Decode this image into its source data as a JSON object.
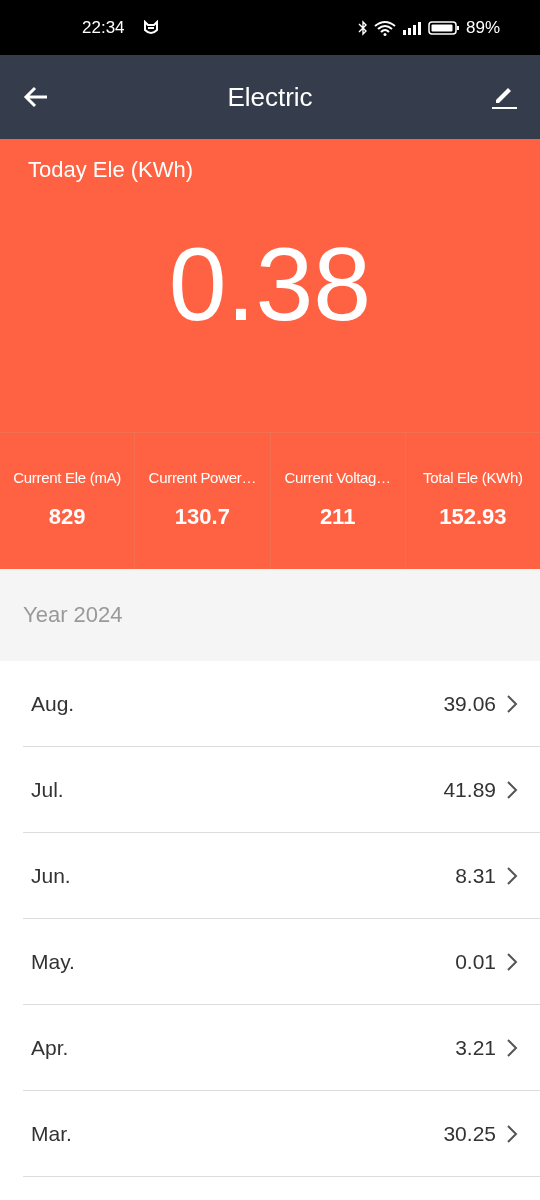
{
  "status_bar": {
    "time": "22:34",
    "battery": "89%"
  },
  "header": {
    "title": "Electric"
  },
  "today": {
    "label": "Today Ele (KWh)",
    "value": "0.38"
  },
  "stats": [
    {
      "label": "Current Ele (mA)",
      "value": "829"
    },
    {
      "label": "Current Power…",
      "value": "130.7"
    },
    {
      "label": "Current Voltag…",
      "value": "211"
    },
    {
      "label": "Total Ele (KWh)",
      "value": "152.93"
    }
  ],
  "year": "Year 2024",
  "months": [
    {
      "month": "Aug.",
      "value": "39.06"
    },
    {
      "month": "Jul.",
      "value": "41.89"
    },
    {
      "month": "Jun.",
      "value": "8.31"
    },
    {
      "month": "May.",
      "value": "0.01"
    },
    {
      "month": "Apr.",
      "value": "3.21"
    },
    {
      "month": "Mar.",
      "value": "30.25"
    }
  ]
}
